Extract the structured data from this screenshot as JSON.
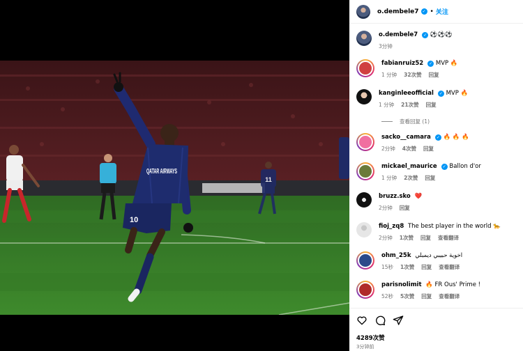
{
  "post": {
    "author": "o.dembele7",
    "follow_label": "关注",
    "dot": "•",
    "caption_emoji": "⚽⚽⚽",
    "caption_time": "3分钟",
    "likes": "4289次赞",
    "time": "3分钟前"
  },
  "photo": {
    "shirt_text": "QATAR AIRWAYS",
    "number_main": "10",
    "number_back": "11"
  },
  "comments": [
    {
      "user": "fabianruiz52",
      "verified": true,
      "text": "MVP 🔥",
      "time": "1 分钟",
      "likes": "32次赞",
      "reply": "回复",
      "translate": ""
    },
    {
      "user": "kanginleeofficial",
      "verified": true,
      "text": "MVP 🔥",
      "time": "1 分钟",
      "likes": "21次赞",
      "reply": "回复",
      "translate": ""
    },
    {
      "user": "sacko__camara",
      "verified": true,
      "text": "🔥 🔥 🔥",
      "time": "2分钟",
      "likes": "4次赞",
      "reply": "回复",
      "translate": ""
    },
    {
      "user": "mickael_maurice",
      "verified": true,
      "text": "Ballon d'or",
      "time": "1 分钟",
      "likes": "2次赞",
      "reply": "回复",
      "translate": ""
    },
    {
      "user": "bruzz.sko",
      "verified": false,
      "text": "❤️",
      "time": "2分钟",
      "likes": "",
      "reply": "回复",
      "translate": ""
    },
    {
      "user": "fioj_zq8",
      "verified": false,
      "text": "The best player in the world 🐆",
      "time": "2分钟",
      "likes": "1次赞",
      "reply": "回复",
      "translate": "查看翻译"
    },
    {
      "user": "ohm_25k",
      "verified": false,
      "text": "اخوية حبيبي ديمبلي",
      "time": "15秒",
      "likes": "1次赞",
      "reply": "回复",
      "translate": "查看翻译"
    },
    {
      "user": "parisnolimit",
      "verified": false,
      "text": "🔥 FR Ous' Prime !",
      "time": "52秒",
      "likes": "5次赞",
      "reply": "回复",
      "translate": "查看翻译"
    }
  ],
  "view_replies": "查看回复 (1)",
  "icons": [
    "heart-icon",
    "comment-icon",
    "share-icon"
  ],
  "colors": {
    "accent": "#0095f6",
    "psg_blue": "#1e2c6e"
  }
}
